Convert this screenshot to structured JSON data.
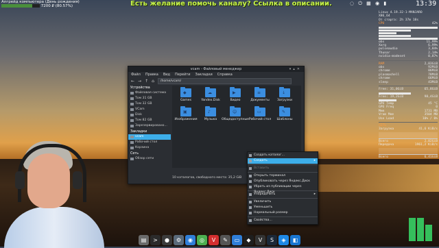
{
  "topbar": {
    "left_line1": "Апгрейд компьютера (День рождения)",
    "left_line2": "7200 ₽ (80.57%)",
    "progress": 0.8057,
    "channel_ad": "Есть желание помочь каналу? Ссылка в описании.",
    "clock": "13:39"
  },
  "conky": {
    "line1": "Linux 4.19.32-1-MANJARO",
    "line2": "X86_64",
    "line3": "От старта: 2h 37m 18s",
    "cpu_label": "42%",
    "procs": [
      {
        "name": "obs",
        "val": "11,99%"
      },
      {
        "name": "Xorg",
        "val": "6,99%"
      },
      {
        "name": "pulseaudio",
        "val": "3,84%"
      },
      {
        "name": "Thunar",
        "val": "2,14%"
      },
      {
        "name": "nvidia-modeset",
        "val": "0,87%"
      }
    ],
    "mem_total": "2,83GiB",
    "mem_procs": [
      {
        "name": "obs",
        "val": "92MiB"
      },
      {
        "name": "chrome",
        "val": "86MiB"
      },
      {
        "name": "plasmashell",
        "val": "78MiB"
      },
      {
        "name": "chrome",
        "val": "66MiB"
      },
      {
        "name": "sleep",
        "val": "43MiB"
      }
    ],
    "fs1": "Free: 31,0GiB",
    "fs1_val": "65,8GiB",
    "fs2": "Free: 19,2GiB",
    "fs2_val": "98,4GiB",
    "gpu_rows": [
      {
        "name": "GPU Temp",
        "val": "45 °C"
      },
      {
        "name": "GPU Freq",
        "val": "0"
      },
      {
        "name": "Mem",
        "val": "1731 MB"
      },
      {
        "name": "Vram Mem",
        "val": "3504 MB"
      },
      {
        "name": "Use Load",
        "val": "10% / 0%"
      }
    ],
    "net_label": "СЕТЬ",
    "net_down": "Загрузка",
    "net_down_val": "41,6 KiB/s",
    "net_total1": "Всего",
    "net_total1_val": "2,02GiB",
    "net_up": "Передача",
    "net_up_val": "1961,2 KiB/s",
    "net_total2": "Всего",
    "net_total2_val": "6,41GiB"
  },
  "filemanager": {
    "title": "vcam - Файловый менеджер",
    "menu": [
      "Файл",
      "Правка",
      "Вид",
      "Перейти",
      "Закладки",
      "Справка"
    ],
    "path": "/home/vcam/",
    "sidebar": [
      {
        "type": "section",
        "label": "Устройства"
      },
      {
        "type": "item",
        "label": "Файловая система"
      },
      {
        "type": "item",
        "label": "Том 31 GB"
      },
      {
        "type": "item",
        "label": "Том 32 GB"
      },
      {
        "type": "item",
        "label": "VCam"
      },
      {
        "type": "item",
        "label": "Disk"
      },
      {
        "type": "item",
        "label": "Том 82 GB"
      },
      {
        "type": "item",
        "label": "Зарезервировано..."
      },
      {
        "type": "section",
        "label": "Закладки"
      },
      {
        "type": "item",
        "label": "vcam",
        "selected": true
      },
      {
        "type": "item",
        "label": "Рабочий стол"
      },
      {
        "type": "item",
        "label": "Корзина"
      },
      {
        "type": "section",
        "label": "Сеть"
      },
      {
        "type": "item",
        "label": "Обзор сети"
      }
    ],
    "files": [
      {
        "label": "Games",
        "glyph": "◆"
      },
      {
        "label": "Yandex.Disk",
        "glyph": "☁"
      },
      {
        "label": "Видео",
        "glyph": "▶"
      },
      {
        "label": "Документы",
        "glyph": "≡"
      },
      {
        "label": "Загрузки",
        "glyph": "↓"
      },
      {
        "label": "Изображения",
        "glyph": "▣"
      },
      {
        "label": "Музыка",
        "glyph": "♪"
      },
      {
        "label": "Общедоступные",
        "glyph": "☺"
      },
      {
        "label": "Рабочий стол",
        "glyph": "▭"
      },
      {
        "label": "Шаблоны",
        "glyph": "✎"
      }
    ],
    "status": "10 каталогов, свободного места: 35,2 GiB"
  },
  "context_menu": [
    {
      "label": "Создать каталог...",
      "icon": "folder-plus-icon"
    },
    {
      "label": "Создать",
      "icon": "new-icon",
      "highlight": true,
      "submenu": true
    },
    {
      "sep": true
    },
    {
      "label": "Вставить",
      "icon": "paste-icon",
      "disabled": true
    },
    {
      "sep": true
    },
    {
      "label": "Открыть терминал",
      "icon": "terminal-icon"
    },
    {
      "label": "Опубликовать через Яндекс.Диск",
      "icon": "share-icon"
    },
    {
      "label": "Убрать из публикации через Яндекс.Диск",
      "icon": "unshare-icon"
    },
    {
      "sep": true
    },
    {
      "label": "Упорядочить",
      "icon": "sort-icon",
      "submenu": true
    },
    {
      "sep": true
    },
    {
      "label": "Увеличить",
      "icon": "zoom-in-icon"
    },
    {
      "label": "Уменьшить",
      "icon": "zoom-out-icon"
    },
    {
      "label": "Нормальный размер",
      "icon": "zoom-reset-icon"
    },
    {
      "sep": true
    },
    {
      "label": "Свойства...",
      "icon": "properties-icon"
    }
  ],
  "dock": [
    {
      "name": "dock-files-icon",
      "color": "#6a6a6a",
      "glyph": "▤"
    },
    {
      "name": "dock-terminal-icon",
      "color": "#2b2b2b",
      "glyph": ">"
    },
    {
      "name": "dock-media-icon",
      "color": "#3b3b3b",
      "glyph": "●"
    },
    {
      "name": "dock-settings-icon",
      "color": "#5a6a7a",
      "glyph": "⚙"
    },
    {
      "name": "dock-browser-icon",
      "color": "#2f7ed8",
      "glyph": "◉"
    },
    {
      "name": "dock-chrome-icon",
      "color": "#4caf50",
      "glyph": "◎"
    },
    {
      "name": "dock-vivaldi-icon",
      "color": "#d32f2f",
      "glyph": "V"
    },
    {
      "name": "dock-editor-icon",
      "color": "#555",
      "glyph": "✎"
    },
    {
      "name": "dock-filemanager-icon",
      "color": "#2f7ed8",
      "glyph": "▭"
    },
    {
      "name": "dock-app-icon",
      "color": "#1e1e1e",
      "glyph": "◆"
    },
    {
      "name": "dock-vnc-icon",
      "color": "#333",
      "glyph": "V"
    },
    {
      "name": "dock-steam-icon",
      "color": "#1b2838",
      "glyph": "S"
    },
    {
      "name": "dock-vbox-icon",
      "color": "#1e88e5",
      "glyph": "◈"
    },
    {
      "name": "dock-package-icon",
      "color": "#1976d2",
      "glyph": "◧"
    }
  ]
}
